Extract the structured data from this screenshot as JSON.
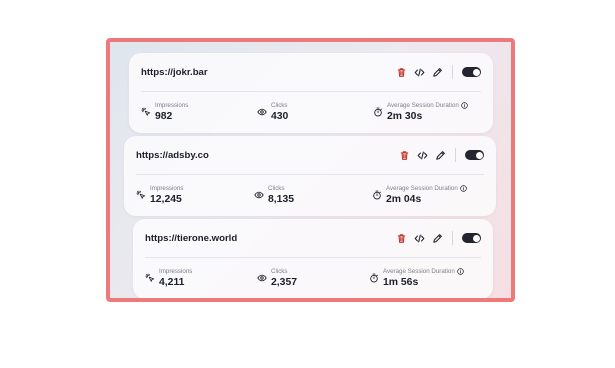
{
  "cards": [
    {
      "url": "https://jokr.bar",
      "impressions_label": "Impressions",
      "impressions": "982",
      "clicks_label": "Clicks",
      "clicks": "430",
      "duration_label": "Average Session Duration",
      "duration": "2m 30s",
      "enabled": true
    },
    {
      "url": "https://adsby.co",
      "impressions_label": "Impressions",
      "impressions": "12,245",
      "clicks_label": "Clicks",
      "clicks": "8,135",
      "duration_label": "Average Session Duration",
      "duration": "2m 04s",
      "enabled": true
    },
    {
      "url": "https://tierone.world",
      "impressions_label": "Impressions",
      "impressions": "4,211",
      "clicks_label": "Clicks",
      "clicks": "2,357",
      "duration_label": "Average Session Duration",
      "duration": "1m 56s",
      "enabled": true
    }
  ],
  "icons": {
    "delete": "trash-icon",
    "embed": "code-icon",
    "edit": "pencil-icon",
    "impressions": "sparkle-cursor-icon",
    "clicks": "eye-icon",
    "duration": "stopwatch-icon",
    "info": "info-icon"
  },
  "colors": {
    "frame_border": "#ec7a7c",
    "delete_icon": "#c0392b",
    "toggle_on": "#23262f"
  }
}
